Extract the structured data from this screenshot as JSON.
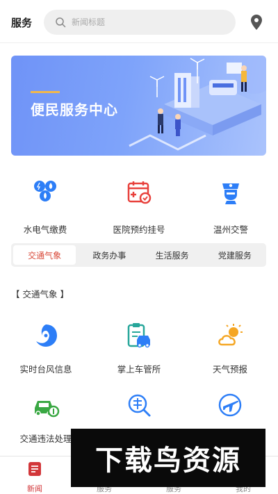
{
  "header": {
    "title": "服务",
    "search_placeholder": "新闻标题"
  },
  "banner": {
    "text": "便民服务中心"
  },
  "services": [
    {
      "label": "水电气缴费",
      "icon": "utility-payment-icon"
    },
    {
      "label": "医院预约挂号",
      "icon": "hospital-appointment-icon"
    },
    {
      "label": "温州交警",
      "icon": "traffic-police-icon"
    }
  ],
  "tabs": [
    {
      "label": "交通气象",
      "active": true
    },
    {
      "label": "政务办事",
      "active": false
    },
    {
      "label": "生活服务",
      "active": false
    },
    {
      "label": "党建服务",
      "active": false
    }
  ],
  "section_title": "【 交通气象 】",
  "grid": [
    {
      "label": "实时台风信息",
      "icon": "typhoon-icon"
    },
    {
      "label": "掌上车管所",
      "icon": "vehicle-office-icon"
    },
    {
      "label": "天气预报",
      "icon": "weather-icon"
    },
    {
      "label": "交通违法处理",
      "icon": "traffic-violation-icon"
    },
    {
      "label": "",
      "icon": "highway-query-icon"
    },
    {
      "label": "",
      "icon": "flight-icon"
    }
  ],
  "tabbar": [
    {
      "label": "新闻",
      "active": true
    },
    {
      "label": "服务",
      "active": false
    },
    {
      "label": "服务",
      "active": false
    },
    {
      "label": "我的",
      "active": false
    }
  ],
  "watermark": "下载鸟资源",
  "colors": {
    "accent": "#d94a3a",
    "blue": "#2d7ef7",
    "green": "#3aa843",
    "orange": "#f5a623"
  }
}
